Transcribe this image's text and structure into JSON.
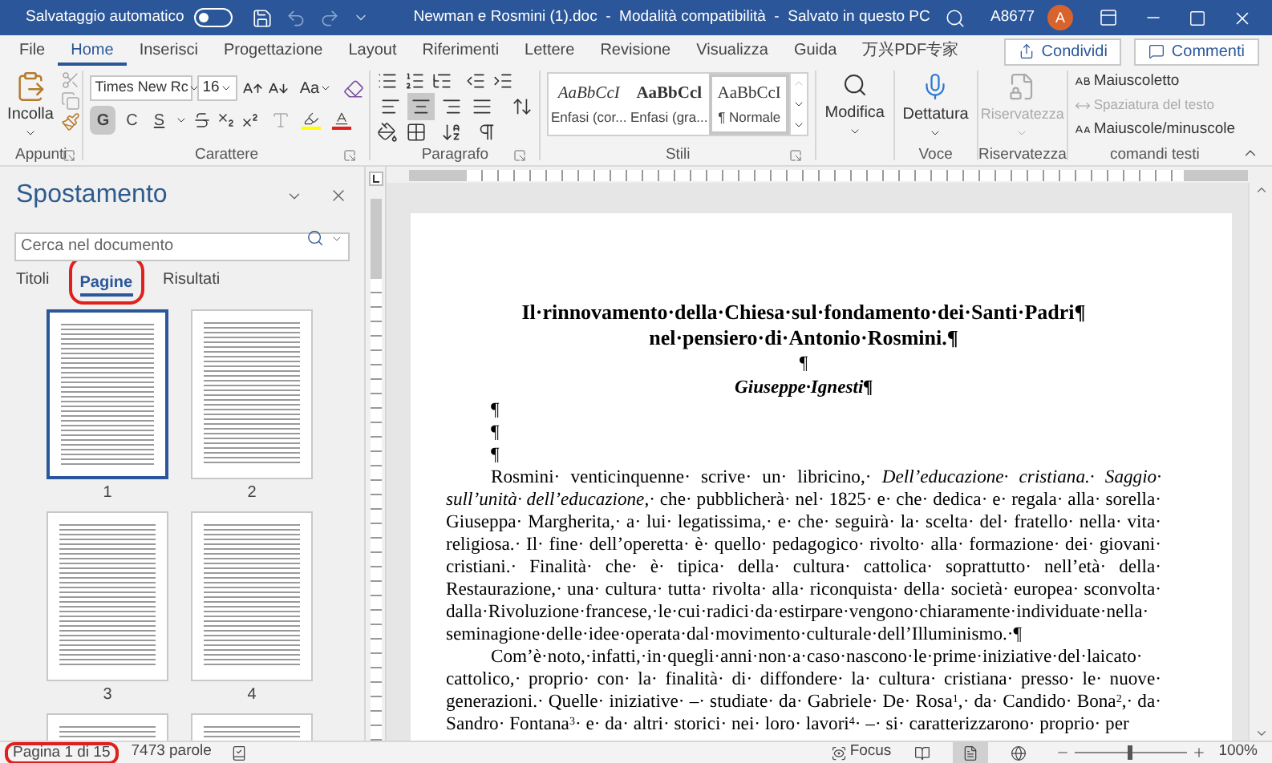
{
  "title_bar": {
    "autosave_label": "Salvataggio automatico",
    "autosave_on": false,
    "document_title": "Newman e Rosmini (1).doc  -  Modalità compatibilità  -  Salvato in questo PC",
    "user": "A8677",
    "avatar_initial": "A"
  },
  "menu_tabs": [
    {
      "label": "File",
      "selected": false
    },
    {
      "label": "Home",
      "selected": true
    },
    {
      "label": "Inserisci",
      "selected": false
    },
    {
      "label": "Progettazione",
      "selected": false
    },
    {
      "label": "Layout",
      "selected": false
    },
    {
      "label": "Riferimenti",
      "selected": false
    },
    {
      "label": "Lettere",
      "selected": false
    },
    {
      "label": "Revisione",
      "selected": false
    },
    {
      "label": "Visualizza",
      "selected": false
    },
    {
      "label": "Guida",
      "selected": false
    },
    {
      "label": "万兴PDF专家",
      "selected": false
    }
  ],
  "share_button": "Condividi",
  "comments_button": "Commenti",
  "ribbon": {
    "clipboard": {
      "paste": "Incolla",
      "group": "Appunti"
    },
    "font": {
      "group": "Carattere",
      "font_name": "Times New Rc",
      "font_size": "16",
      "change_case": "Aa",
      "bold": "G",
      "italic": "C",
      "underline": "S",
      "bold_on": true
    },
    "paragraph": {
      "group": "Paragrafo",
      "alignment": [
        {
          "selected": false
        },
        {
          "selected": true
        },
        {
          "selected": false
        },
        {
          "selected": false
        }
      ]
    },
    "styles": {
      "group": "Stili",
      "items": [
        {
          "sample": "AaBbCcI",
          "name": "Enfasi (cor...",
          "kind": "italic",
          "selected": false
        },
        {
          "sample": "AaBbCcl",
          "name": "Enfasi (gra...",
          "kind": "bold",
          "selected": false
        },
        {
          "sample": "AaBbCcI",
          "name": "¶ Normale",
          "kind": "normal",
          "selected": true
        }
      ]
    },
    "editing": {
      "label": "Modifica"
    },
    "voice": {
      "label": "Dettatura",
      "group": "Voce"
    },
    "privacy": {
      "label": "Riservatezza",
      "group": "Riservatezza",
      "disabled": true
    },
    "text_commands": {
      "group": "comandi testi",
      "items": [
        {
          "label": "Maiuscoletto",
          "disabled": false
        },
        {
          "label": "Spaziatura del testo",
          "disabled": true
        },
        {
          "label": "Maiuscole/minuscole",
          "disabled": false
        }
      ]
    }
  },
  "nav_pane": {
    "title": "Spostamento",
    "search_placeholder": "Cerca nel documento",
    "tabs": [
      {
        "label": "Titoli",
        "selected": false
      },
      {
        "label": "Pagine",
        "selected": true
      },
      {
        "label": "Risultati",
        "selected": false
      }
    ],
    "thumbnails": [
      {
        "number": "1",
        "selected": true
      },
      {
        "number": "2",
        "selected": false
      },
      {
        "number": "3",
        "selected": false
      },
      {
        "number": "4",
        "selected": false
      },
      {
        "selected": false
      },
      {
        "selected": false
      }
    ]
  },
  "document": {
    "title_lines": [
      "Il·rinnovamento·della·Chiesa·sul·fondamento·dei·Santi·Padri¶",
      "nel·pensiero·di·Antonio·Rosmini.¶"
    ],
    "empty_mark": "¶",
    "author": "Giuseppe·Ignesti¶",
    "blank_marks": [
      "¶",
      "¶",
      "¶"
    ],
    "paragraphs": [
      "Rosmini· venticinquenne· scrive· un· libricino,· *Dell’educazione· cristiana.· Saggio· sull’unità· dell’educazione*,· che· pubblicherà· nel· 1825· e· che· dedica· e· regala· alla· sorella· Giuseppa· Margherita,· a· lui· legatissima,· e· che· seguirà· la· scelta· del· fratello· nella· vita· religiosa.· Il· fine· dell’operetta· è· quello· pedagogico· rivolto· alla· formazione· dei· giovani· cristiani.· Finalità· che· è· tipica· della· cultura· cattolica· soprattutto· nell’età· della· Restaurazione,· una· cultura· tutta· rivolta· alla· riconquista· della· società· europea· sconvolta· dalla·Rivoluzione·francese,·le·cui·radici·da·estirpare·vengono·chiaramente·individuate·nella· seminagione·delle·idee·operata·dal·movimento·culturale·dell’Illuminismo.·¶",
      "Com’è·noto,·infatti,·in·quegli·anni·non·a·caso·nascono·le·prime·iniziative·del·laicato· cattolico,· proprio· con· la· finalità· di· diffondere· la· cultura· cristiana· presso· le· nuove· generazioni.· Quelle· iniziative· –· studiate· da· Gabriele· De· Rosa$^{1}$,· da· Candido· Bona$^{2}$,· da· Sandro· Fontana$^{3}$· e· da· altri· storici· nei· loro· lavori$^{4}$· –· si· caratterizzarono· proprio· per"
    ]
  },
  "status_bar": {
    "page": "Pagina 1 di 15",
    "words": "7473 parole",
    "focus": "Focus",
    "views": [
      {
        "selected": false
      },
      {
        "selected": true
      },
      {
        "selected": false
      }
    ],
    "zoom_slider": {
      "level": 0.5
    },
    "zoom": "100%"
  }
}
